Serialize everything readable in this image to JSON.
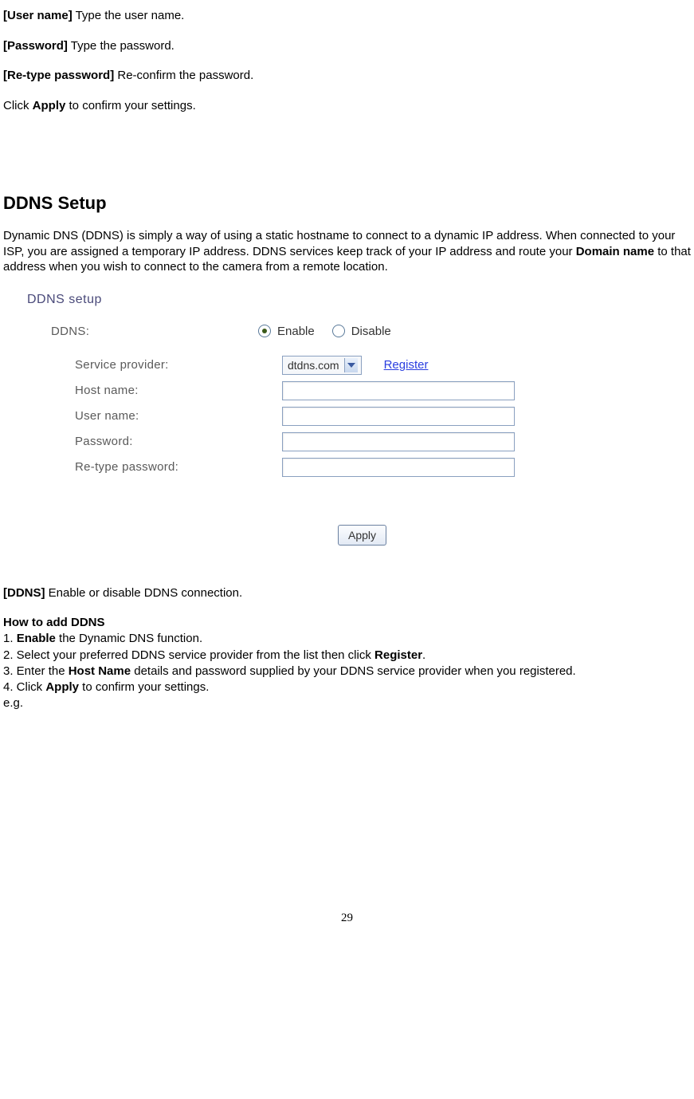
{
  "top": {
    "username_label": "[User name]",
    "username_text": " Type the user name.",
    "password_label": "[Password]",
    "password_text": " Type the password.",
    "retype_label": "[Re-type password]",
    "retype_text": " Re-confirm the password.",
    "click_prefix": "Click ",
    "apply_word": "Apply",
    "click_suffix": " to confirm your settings."
  },
  "section_title": "DDNS Setup",
  "intro": {
    "p1a": "Dynamic DNS (DDNS) is simply a way of using a static hostname to connect to a dynamic IP address. When connected to your ISP, you are assigned a temporary IP address. DDNS services keep track of your IP address and route your ",
    "domain_name": "Domain name",
    "p1b": " to that address when you wish to connect to the camera from a remote location."
  },
  "screenshot": {
    "title": "DDNS setup",
    "ddns_label": "DDNS:",
    "enable": "Enable",
    "disable": "Disable",
    "service_provider": "Service provider:",
    "provider_value": "dtdns.com",
    "register": "Register",
    "host_name": "Host name:",
    "user_name": "User name:",
    "password": "Password:",
    "retype_password": "Re-type password:",
    "apply": "Apply"
  },
  "after": {
    "ddns_label": "[DDNS]",
    "ddns_text": " Enable or disable DDNS connection.",
    "how_heading": "How to add DDNS",
    "s1a": "1. ",
    "s1b": "Enable",
    "s1c": " the Dynamic DNS function.",
    "s2a": "2. Select your preferred DDNS service provider from the list then click ",
    "s2b": "Register",
    "s2c": ".",
    "s3a": "3. Enter the ",
    "s3b": "Host Name",
    "s3c": " details and password supplied by your DDNS service provider when you registered.",
    "s4a": "4. Click ",
    "s4b": "Apply",
    "s4c": " to confirm your settings.",
    "eg": "e.g."
  },
  "page_number": "29"
}
